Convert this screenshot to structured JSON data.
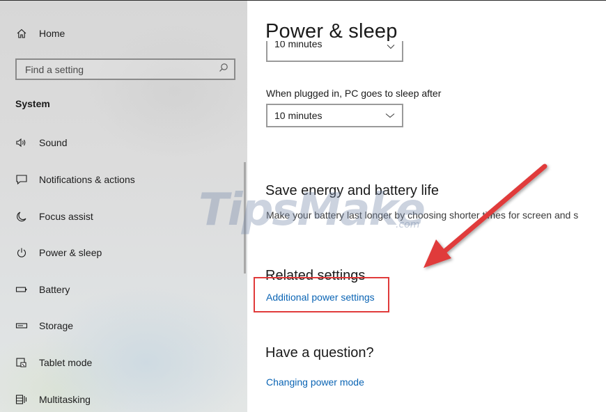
{
  "sidebar": {
    "home_label": "Home",
    "search": {
      "placeholder": "Find a setting",
      "value": ""
    },
    "section": "System",
    "items": [
      {
        "label": "Sound",
        "icon": "speaker-icon"
      },
      {
        "label": "Notifications & actions",
        "icon": "message-icon"
      },
      {
        "label": "Focus assist",
        "icon": "moon-icon"
      },
      {
        "label": "Power & sleep",
        "icon": "power-icon"
      },
      {
        "label": "Battery",
        "icon": "battery-icon"
      },
      {
        "label": "Storage",
        "icon": "storage-icon"
      },
      {
        "label": "Tablet mode",
        "icon": "tablet-mode-icon"
      },
      {
        "label": "Multitasking",
        "icon": "multitasking-icon"
      }
    ]
  },
  "main": {
    "title": "Power & sleep",
    "screen_dropdown_value": "10 minutes",
    "sleep_label": "When plugged in, PC goes to sleep after",
    "sleep_dropdown_value": "10 minutes",
    "save_energy_heading": "Save energy and battery life",
    "save_energy_desc": "Make your battery last longer by choosing shorter times for screen and s",
    "related_heading": "Related settings",
    "related_link": "Additional power settings",
    "question_heading": "Have a question?",
    "question_link": "Changing power mode"
  },
  "overlay": {
    "watermark": "TipsMake",
    "watermark_suffix": ".com",
    "annotation_color": "#e03a3a"
  }
}
